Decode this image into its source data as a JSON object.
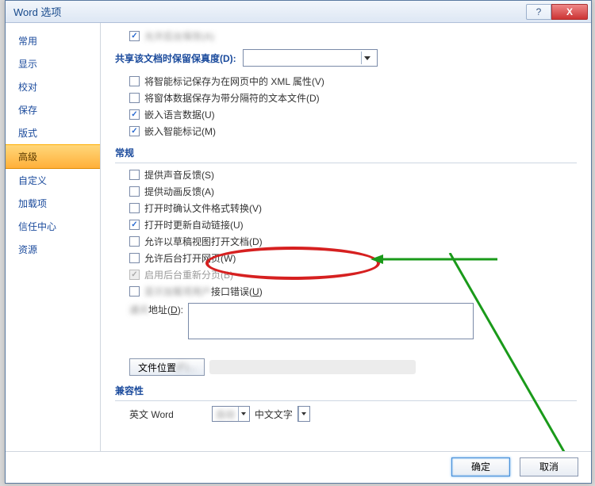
{
  "window": {
    "title": "Word 选项"
  },
  "sysbtns": {
    "help": "?",
    "close": "X"
  },
  "sidebar": {
    "items": [
      {
        "label": "常用"
      },
      {
        "label": "显示"
      },
      {
        "label": "校对"
      },
      {
        "label": "保存"
      },
      {
        "label": "版式"
      },
      {
        "label": "高级",
        "active": true
      },
      {
        "label": "自定义"
      },
      {
        "label": "加载项"
      },
      {
        "label": "信任中心"
      },
      {
        "label": "资源"
      }
    ]
  },
  "top_checkbox": {
    "label": "允许后台保存(A)",
    "checked": true
  },
  "share": {
    "label": "共享该文档时保留保真度(D):"
  },
  "share_opts": [
    {
      "label": "将智能标记保存为在网页中的 XML 属性(V)",
      "checked": false
    },
    {
      "label": "将窗体数据保存为带分隔符的文本文件(D)",
      "checked": false
    },
    {
      "label": "嵌入语言数据(U)",
      "checked": true
    },
    {
      "label": "嵌入智能标记(M)",
      "checked": true
    }
  ],
  "section_general": "常规",
  "general_opts": [
    {
      "label": "提供声音反馈(S)",
      "checked": false
    },
    {
      "label": "提供动画反馈(A)",
      "checked": false
    },
    {
      "label": "打开时确认文件格式转换(V)",
      "checked": false
    },
    {
      "label": "打开时更新自动链接(U)",
      "checked": true,
      "highlight": true
    },
    {
      "label": "允许以草稿视图打开文档(D)",
      "checked": false
    },
    {
      "label": "允许后台打开网页(W)",
      "checked": false
    },
    {
      "label": "启用后台重新分页(B)",
      "checked": true,
      "disabled": true
    },
    {
      "label": "显示加载项用户接口错误(U)",
      "checked": false
    }
  ],
  "address": {
    "label": "通讯地址(D):"
  },
  "fileloc_btn": "文件位置(F)...",
  "section_compat": "兼容性",
  "compat_line": {
    "prefix": "英文 Word",
    "mid": "自动",
    "suffix": "中文文字"
  },
  "footer": {
    "ok": "确定",
    "cancel": "取消"
  }
}
